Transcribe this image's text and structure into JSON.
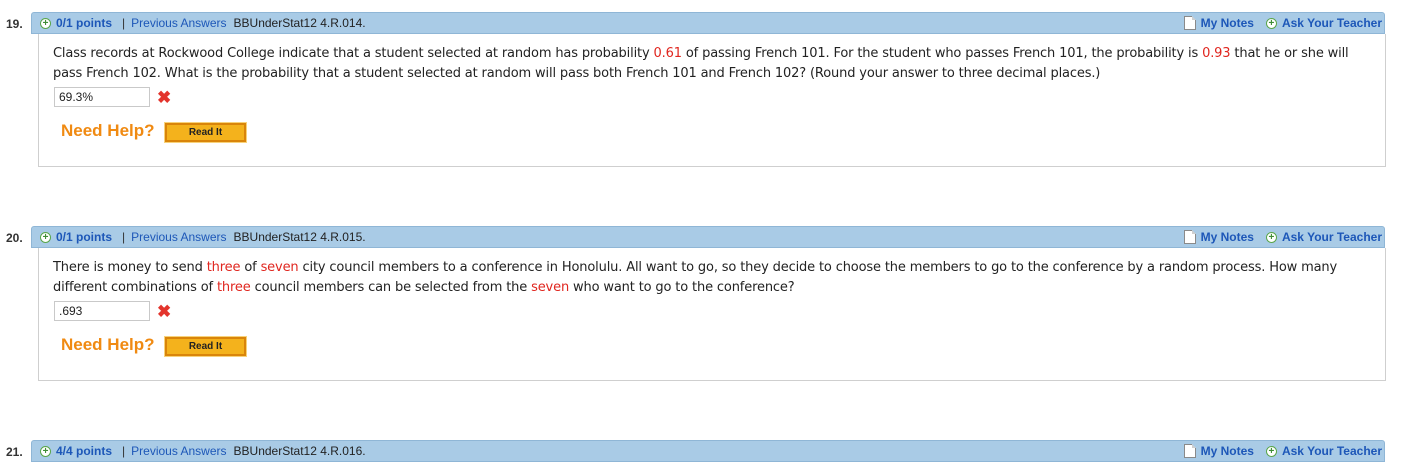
{
  "questions": [
    {
      "number": "19.",
      "points": "0/1 points",
      "separator": "|",
      "previous_answers": "Previous Answers",
      "code": "BBUnderStat12 4.R.014.",
      "my_notes": "My Notes",
      "ask_teacher": "Ask Your Teacher",
      "text": {
        "p1": "Class records at Rockwood College indicate that a student selected at random has probability ",
        "v1": "0.61",
        "p2": " of passing French 101. For the student who passes French 101, the probability is ",
        "v2": "0.93",
        "p3": " that he or she will pass French 102. What is the probability that a student selected at random will pass both French 101 and French 102? (Round your answer to three decimal places.)"
      },
      "answer": "69.3%",
      "need_help": "Need Help?",
      "read_it": "Read It"
    },
    {
      "number": "20.",
      "points": "0/1 points",
      "separator": "|",
      "previous_answers": "Previous Answers",
      "code": "BBUnderStat12 4.R.015.",
      "my_notes": "My Notes",
      "ask_teacher": "Ask Your Teacher",
      "text": {
        "p1": "There is money to send ",
        "v1": "three",
        "p2": " of ",
        "v2": "seven",
        "p3": " city council members to a conference in Honolulu. All want to go, so they decide to choose the members to go to the conference by a random process. How many different combinations of ",
        "v3": "three",
        "p4": " council members can be selected from the ",
        "v4": "seven",
        "p5": " who want to go to the conference?"
      },
      "answer": ".693",
      "need_help": "Need Help?",
      "read_it": "Read It"
    },
    {
      "number": "21.",
      "points": "4/4 points",
      "separator": "|",
      "previous_answers": "Previous Answers",
      "code": "BBUnderStat12 4.R.016.",
      "my_notes": "My Notes",
      "ask_teacher": "Ask Your Teacher"
    }
  ],
  "icons": {
    "plus": "+",
    "incorrect": "✖"
  },
  "colors": {
    "header_bar": "#a9cbe6",
    "link": "#1d57b8",
    "variable_red": "#e0261f",
    "need_help_orange": "#f08a12",
    "read_it_button": "#f4b21c"
  }
}
